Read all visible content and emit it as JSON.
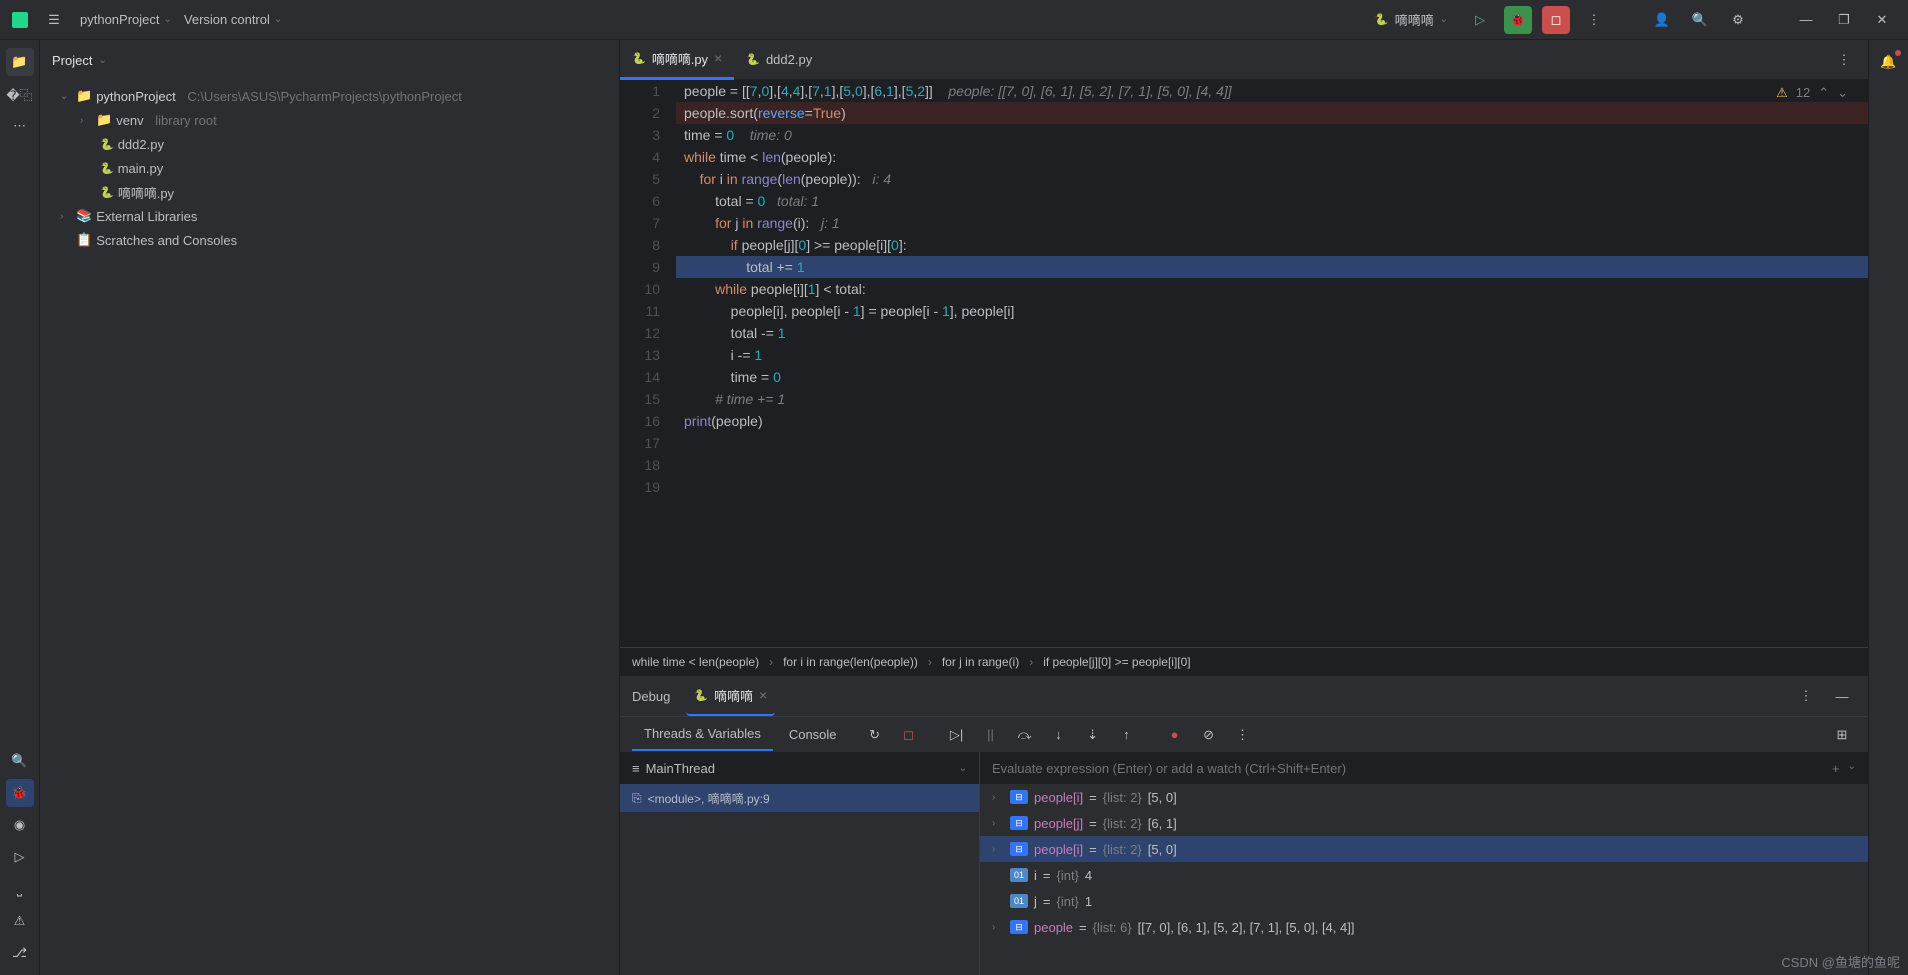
{
  "titlebar": {
    "project_name": "pythonProject",
    "vcs": "Version control",
    "run_config": "嘀嘀嘀"
  },
  "project": {
    "header": "Project",
    "root": "pythonProject",
    "root_path": "C:\\Users\\ASUS\\PycharmProjects\\pythonProject",
    "venv": "venv",
    "venv_hint": "library root",
    "files": [
      "ddd2.py",
      "main.py",
      "嘀嘀嘀.py"
    ],
    "external": "External Libraries",
    "scratches": "Scratches and Consoles"
  },
  "tabs": {
    "active": "嘀嘀嘀.py",
    "other": "ddd2.py"
  },
  "editor": {
    "problems": "12",
    "lines": [
      "1",
      "2",
      "3",
      "4",
      "5",
      "6",
      "7",
      "8",
      "9",
      "10",
      "11",
      "12",
      "13",
      "14",
      "15",
      "16",
      "17",
      "18",
      "19"
    ],
    "inlay_line1": "people: [[7, 0], [6, 1], [5, 2], [7, 1], [5, 0], [4, 4]]",
    "inlay_line3": "time: 0",
    "inlay_line5": "i: 4",
    "inlay_line6": "total: 1",
    "inlay_line7": "j: 1"
  },
  "breadcrumb": {
    "b1": "while time < len(people)",
    "b2": "for i in range(len(people))",
    "b3": "for j in range(i)",
    "b4": "if people[j][0] >= people[i][0]"
  },
  "debug": {
    "title": "Debug",
    "config": "嘀嘀嘀",
    "tab_threads": "Threads & Variables",
    "tab_console": "Console",
    "thread": "MainThread",
    "frame": "<module>, 嘀嘀嘀.py:9",
    "eval_placeholder": "Evaluate expression (Enter) or add a watch (Ctrl+Shift+Enter)",
    "vars": [
      {
        "name": "people[i]",
        "type": "{list: 2}",
        "value": "[5, 0]"
      },
      {
        "name": "people[j]",
        "type": "{list: 2}",
        "value": "[6, 1]"
      },
      {
        "name": "people[i]",
        "type": "{list: 2}",
        "value": "[5, 0]"
      },
      {
        "name": "i",
        "type": "{int}",
        "value": "4"
      },
      {
        "name": "j",
        "type": "{int}",
        "value": "1"
      },
      {
        "name": "people",
        "type": "{list: 6}",
        "value": "[[7, 0], [6, 1], [5, 2], [7, 1], [5, 0], [4, 4]]"
      }
    ]
  },
  "watermark": "CSDN @鱼塘的鱼呢"
}
